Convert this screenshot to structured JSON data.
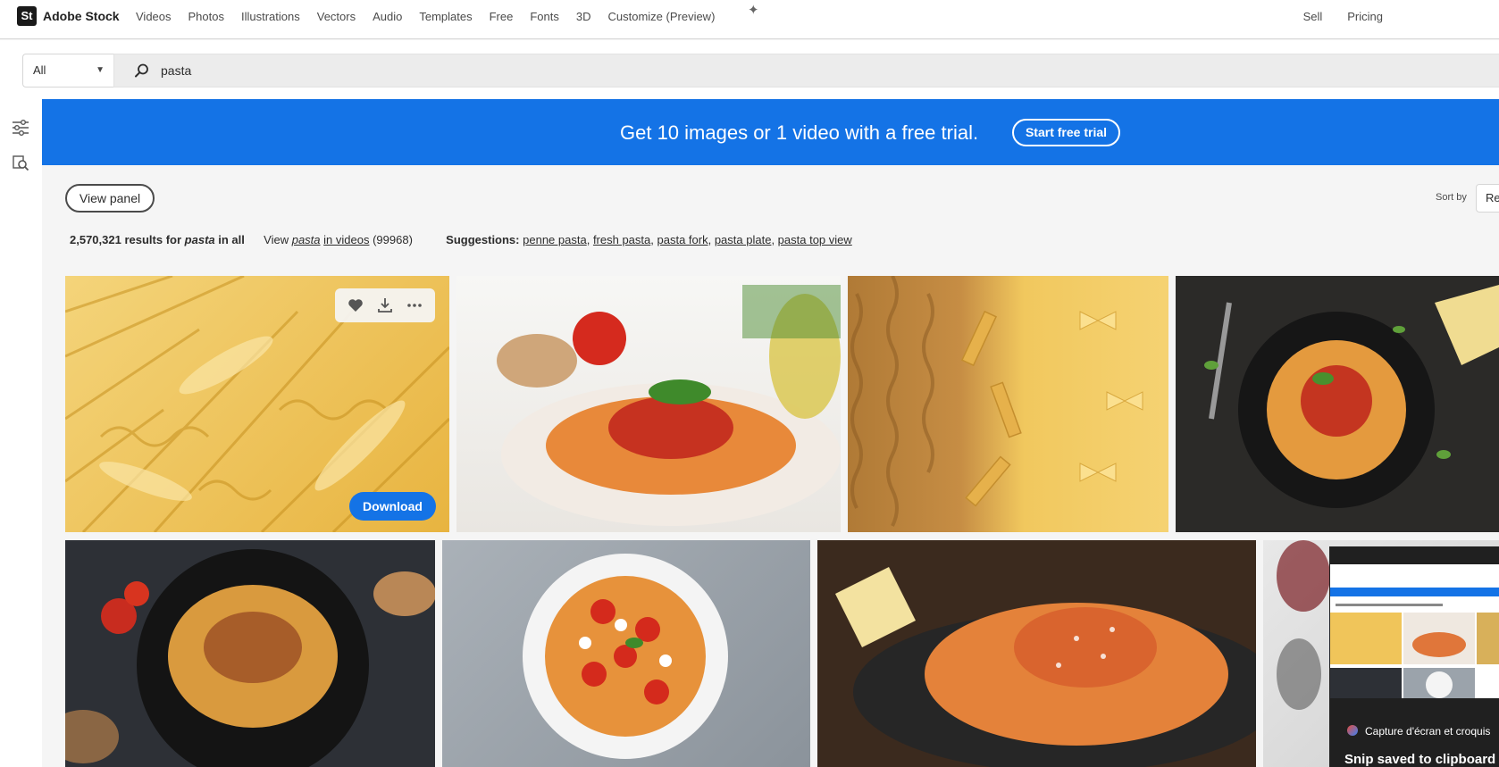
{
  "brand": {
    "logo_letters": "St",
    "name": "Adobe Stock"
  },
  "nav": {
    "items": [
      "Videos",
      "Photos",
      "Illustrations",
      "Vectors",
      "Audio",
      "Templates",
      "Free",
      "Fonts",
      "3D",
      "Customize (Preview)"
    ],
    "sell": "Sell",
    "pricing": "Pricing"
  },
  "search": {
    "category": "All",
    "query": "pasta"
  },
  "promo": {
    "text": "Get 10 images or 1 video with a free trial.",
    "button": "Start free trial"
  },
  "controls": {
    "view_panel": "View panel",
    "sort_by_label": "Sort by",
    "sort_value": "Re"
  },
  "results": {
    "count": "2,570,321",
    "count_suffix": "results for",
    "term": "pasta",
    "in_all": "in all",
    "view_prefix": "View",
    "view_term": "pasta",
    "view_in": "in videos",
    "video_count": "(99968)",
    "suggestions_label": "Suggestions:",
    "suggestions": [
      "penne pasta",
      "fresh pasta",
      "pasta fork",
      "pasta plate",
      "pasta top view"
    ]
  },
  "tiles": [
    {
      "name": "dry-pasta-assortment"
    },
    {
      "name": "spaghetti-tomato-plate"
    },
    {
      "name": "fusilli-penne-farfalle"
    },
    {
      "name": "spaghetti-dark-plate"
    },
    {
      "name": "tagliatelle-bolognese"
    },
    {
      "name": "penne-tomato-bowl"
    },
    {
      "name": "spaghetti-parmesan"
    },
    {
      "name": "partial-tile"
    }
  ],
  "first_tile_actions": {
    "download": "Download"
  },
  "snip": {
    "app": "Capture d'écran et croquis",
    "message": "Snip saved to clipboard"
  },
  "colors": {
    "accent": "#1473e6",
    "nav_bg": "#ffffff",
    "page_bg": "#f5f5f5"
  }
}
